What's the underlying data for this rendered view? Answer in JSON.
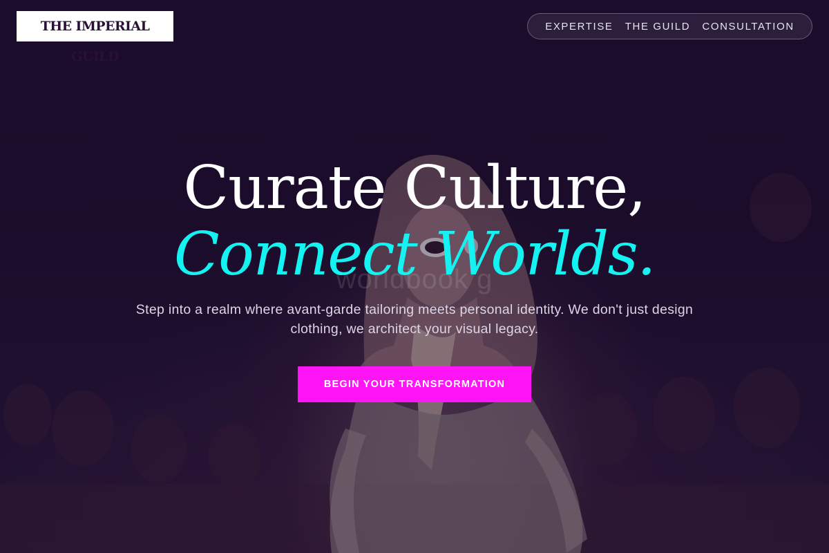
{
  "brand": {
    "logo_text": "THE IMPERIAL GUILD"
  },
  "nav": {
    "items": [
      {
        "label": "EXPERTISE"
      },
      {
        "label": "THE GUILD"
      },
      {
        "label": "CONSULTATION"
      }
    ]
  },
  "hero": {
    "headline_line1": "Curate Culture,",
    "headline_line2": "Connect Worlds.",
    "watermark": "worldbook g",
    "subtext": "Step into a realm where avant-garde tailoring meets personal identity. We don't just design clothing, we architect your visual legacy.",
    "cta_label": "BEGIN YOUR TRANSFORMATION"
  },
  "colors": {
    "accent_cyan": "#14f2f2",
    "cta_magenta": "#ff14f5",
    "background_dark": "#1b0e2b"
  }
}
